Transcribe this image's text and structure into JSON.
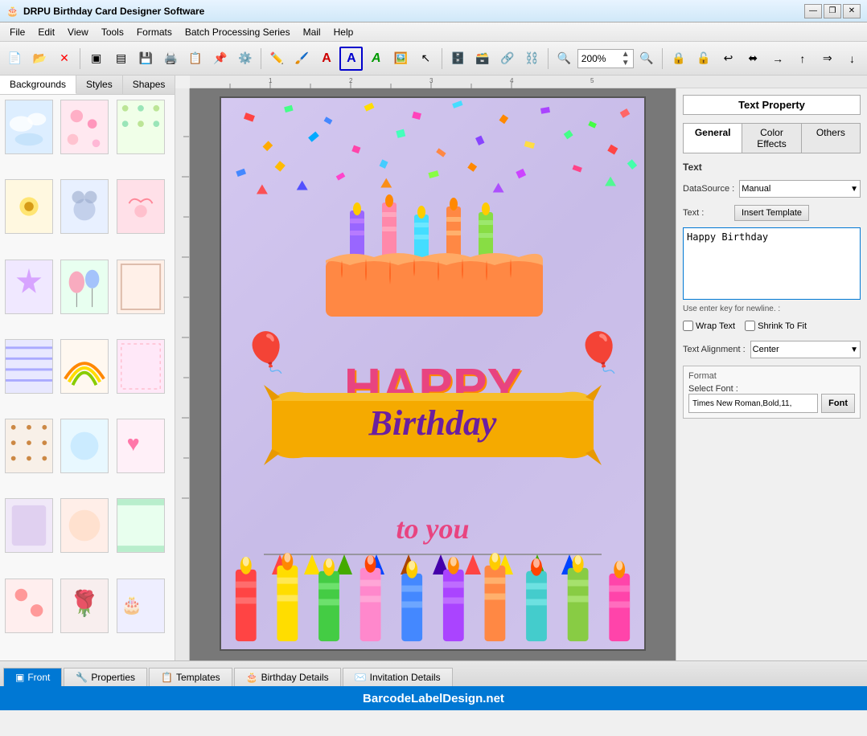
{
  "titlebar": {
    "title": "DRPU Birthday Card Designer Software",
    "icon": "🎂",
    "controls": [
      "—",
      "❐",
      "✕"
    ]
  },
  "menubar": {
    "items": [
      "File",
      "Edit",
      "View",
      "Tools",
      "Formats",
      "Batch Processing Series",
      "Mail",
      "Help"
    ]
  },
  "toolbar": {
    "zoom_value": "200%",
    "zoom_placeholder": "200%"
  },
  "left_panel": {
    "tabs": [
      "Backgrounds",
      "Styles",
      "Shapes"
    ],
    "active_tab": "Backgrounds"
  },
  "right_panel": {
    "title": "Text Property",
    "tabs": [
      "General",
      "Color Effects",
      "Others"
    ],
    "active_tab": "General",
    "datasource_label": "DataSource :",
    "datasource_value": "Manual",
    "text_label": "Text :",
    "insert_template_btn": "Insert Template",
    "text_content": "Happy Birthday",
    "hint": "Use enter key for newline. :",
    "wrap_text_label": "Wrap Text",
    "shrink_to_label": "Shrink To Fit",
    "text_alignment_label": "Text Alignment :",
    "text_alignment_value": "Center",
    "format_label": "Format",
    "select_font_label": "Select Font :",
    "font_value": "Times New Roman,Bold,11,",
    "font_btn": "Font"
  },
  "bottom_tabs": {
    "tabs": [
      "Front",
      "Properties",
      "Templates",
      "Birthday Details",
      "Invitation Details"
    ],
    "active": "Front"
  },
  "footer": {
    "text": "BarcodeLabel Design.net",
    "display": "BarcodeLabelDesign.net"
  },
  "card": {
    "text_happy": "HAPPY",
    "text_birthday": "Birthday",
    "text_toyou": "to you"
  },
  "thumbnails": [
    {
      "bg": "#e8f4ff",
      "type": "clouds"
    },
    {
      "bg": "#ffe8f0",
      "type": "flowers"
    },
    {
      "bg": "#f0ffe8",
      "type": "pattern"
    },
    {
      "bg": "#fff8e0",
      "type": "sunflowers"
    },
    {
      "bg": "#e8f0ff",
      "type": "bears"
    },
    {
      "bg": "#ffe0e8",
      "type": "birds"
    },
    {
      "bg": "#f0e8ff",
      "type": "stars"
    },
    {
      "bg": "#e8fff0",
      "type": "balloons"
    },
    {
      "bg": "#fff0e8",
      "type": "beige"
    },
    {
      "bg": "#ffe8e8",
      "type": "pink"
    },
    {
      "bg": "#e8e8ff",
      "type": "rainbow"
    },
    {
      "bg": "#fff8f0",
      "type": "cream"
    },
    {
      "bg": "#f0ffe8",
      "type": "stripes"
    },
    {
      "bg": "#ffe8f8",
      "type": "pink2"
    },
    {
      "bg": "#f8f0e8",
      "type": "dots"
    },
    {
      "bg": "#e8f8ff",
      "type": "blue"
    },
    {
      "bg": "#fff0f8",
      "type": "hearts"
    },
    {
      "bg": "#f0e8f8",
      "type": "lavender"
    },
    {
      "bg": "#ffeee8",
      "type": "peach"
    },
    {
      "bg": "#e8ffee",
      "type": "mint"
    },
    {
      "bg": "#ffeeee",
      "type": "red"
    },
    {
      "bg": "#eeeeff",
      "type": "card"
    },
    {
      "bg": "#f8eeee",
      "type": "roses"
    },
    {
      "bg": "#eef8ee",
      "type": "green"
    }
  ]
}
